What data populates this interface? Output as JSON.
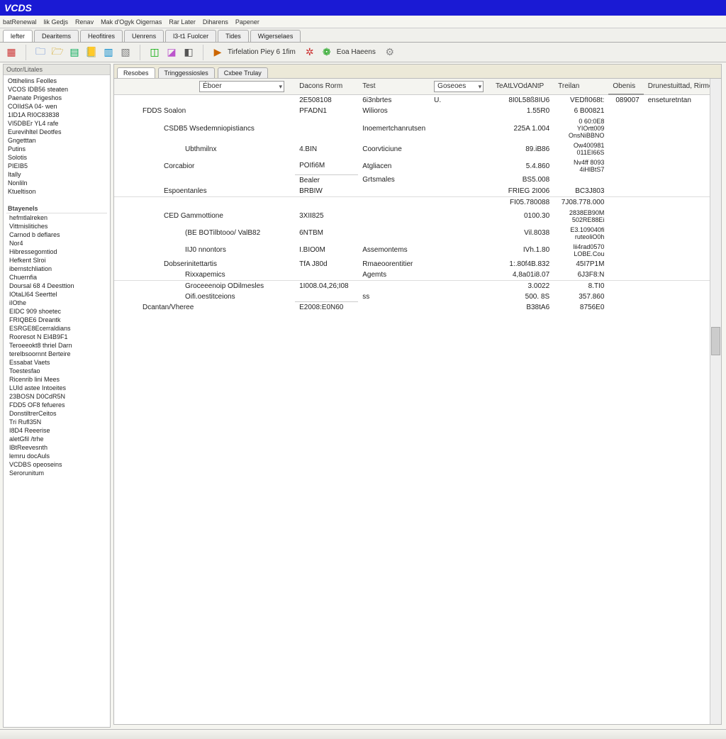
{
  "title": "VCDS",
  "menu": [
    "batRenewal",
    "lik Gedjs",
    "Renav",
    "Mak d'Ogyk Oigernas",
    "Rar Later",
    "Diharens",
    "Papener"
  ],
  "tabs": [
    "lefter",
    "Dearitems",
    "Heofitires",
    "Uenrens",
    "l3-t1  Fuolcer",
    "Tides",
    "Wigerselaes"
  ],
  "toolbar_icons": [
    "doc",
    "open",
    "open2",
    "save",
    "book",
    "sheet",
    "sheet2",
    "pict",
    "shape",
    "chart",
    "gear",
    "gear2"
  ],
  "toolbar_play": "▶",
  "toolbar_text1": "Tirfelation Piey 6 1fim",
  "toolbar_text2": "Eoa Haeens",
  "side_header": "Outor/Litales",
  "side_group1": [
    "Ottihelins Feolles",
    "VCOS IDB56 steaten",
    "Paenate  Prigeshos",
    "COIIdSA 04- wen",
    "1ID1A  RI0C83838",
    "VI5DBEr YL4  rafe",
    "Eurevihltel Deotfes",
    "Gngetttan",
    "Putins",
    "Solotis",
    "PIEIB5",
    "Itally",
    "Nonliln",
    "Ktueltison"
  ],
  "side_hdr2": "Btayenels",
  "side_group2": [
    "hefmtlalreken",
    "Vittmislitiches",
    "Carnod b deflares",
    "Nor4",
    "Hibressegomtiod",
    "Hefkent Slroi",
    "ibernstchliation",
    "Chuernfia",
    "Doursal 68 4 Deesttion",
    "IOtaLl64 Seerttel",
    "iIOthe",
    "EIDC 909 shoetec",
    "FRIQBE6 Dreantk",
    "ESRGE8Ecerraldians",
    "Rooresot N El4B9F1",
    "Teroeeokt8 thriel Darn",
    "terelbsoornnt Berteire",
    "Essabat Vaets",
    "Toestesfao",
    "Ricenrib lini Mees",
    "LUId astee  Intoeites",
    "23BOSN D0CdR5N",
    "FDD5 OF8 fefueres",
    "DonstiltrerCeitos",
    "Tri Rufl35N",
    "I8D4 Reeerise",
    "aletGfil /trhe",
    "IBtReevesnth",
    "lemru docAuls",
    "VCDBS opeoseins",
    "Serorunitum"
  ],
  "subtabs": [
    "Resobes",
    "Tringgessiosles",
    "Cxbee  Trulay"
  ],
  "grid": {
    "header_dd1": "Éboer",
    "header_col2": "Dacons Rorm",
    "header_col3": "Test",
    "header_dd2": "Goseoes",
    "header_col5": "TeAtLVOdANtP",
    "header_col6": "Treilan",
    "header_col7": "Obenis",
    "header_col8": "Drunestuittad, Rirmed",
    "rows": [
      {
        "c1": "",
        "c2": "2E508108",
        "c3": "6i3nbrtes",
        "c3b": "U.",
        "c4": "8I0L58ß8IU6",
        "c5": "VEDfI068t:",
        "c6": "089007",
        "c7": "enseturetntan"
      },
      {
        "c1": "FDDS Soalon",
        "c2": "PFADN1",
        "c3": "Wilioros",
        "c4": "1.55R0",
        "c5": "6 B00821"
      },
      {
        "indent": 2,
        "c1": "CSDB5 Wsedemniopistiancs",
        "c3": "Inoemertchanrutsen",
        "c4": "225A 1.004",
        "c5b": [
          "0 60:0E8",
          "YIOrtt009",
          "OnsNiBBNO"
        ]
      },
      {
        "indent": 3,
        "c1": "Ubthmilnx",
        "c2": "4.BIN",
        "c3": "Coorvticiune",
        "c4": "89.iB86",
        "c5b": [
          "Ow400981",
          "011EI66S"
        ]
      },
      {
        "indent": 2,
        "c1": "Corcabior",
        "c2": "POIfi6M",
        "c3": "Atgliacen",
        "c4": "5.4.860",
        "c5b": [
          "Nv4ff 8093",
          "4iHlBtS7"
        ]
      },
      {
        "c2sep": true,
        "c2": "Bealer",
        "c3": "Grtsmales",
        "c4": "BS5.008"
      },
      {
        "indent": 2,
        "c1": "Espoentanles",
        "c2": "BRBIW",
        "c4": "FRIEG 2I006",
        "c5": "BC3J803"
      },
      {
        "sep": true,
        "c4": "FI05.780088",
        "c5": "7J08.778.000"
      },
      {
        "indent": 2,
        "c1": "CED Gammottione",
        "c2": "3XII825",
        "c4": "0100.30",
        "c5b": [
          "2838EB90M",
          "502RE88Ei"
        ]
      },
      {
        "indent": 3,
        "c1": "(BE BOTilbtooo/ ValB82",
        "c2": "6NTBM",
        "c4": "Vil.8038",
        "c5b": [
          "E3.109040fi",
          "ruteoliO0h"
        ]
      },
      {
        "indent": 3,
        "c1": "IIJ0 nnontors",
        "c2": "I.BIO0M",
        "c3": "Assemontems",
        "c4": "IVh.1.80",
        "c5b": [
          "lii4rad0570",
          "LOBE.Cou"
        ]
      },
      {
        "indent": 2,
        "c1": "Dobserinitettartis",
        "c2": "TfA J80d",
        "c3": "Rmaeoorentitier",
        "c4": "1:.80f4B.832",
        "c5": "45I7P1M"
      },
      {
        "indent": 3,
        "c1": "Rixxapemics",
        "c3": "Agemts",
        "c4": "4,8a01i8.07",
        "c5": "6J3F8:N"
      },
      {
        "sep": true,
        "indent": 3,
        "c1": "Groceeenoip ODilmesles",
        "c2": "1I008.04,26;I08",
        "c4": "3.0022",
        "c5": "8.TI0"
      },
      {
        "indent": 3,
        "c1": "Oifi.oestitceions",
        "c3": "ss",
        "c4": "500. 8S",
        "c5": "357.860"
      },
      {
        "c1": "Dcantan/Vheree",
        "c2_sep": true,
        "c2": "E2008:E0N60",
        "c4": "B38tA6",
        "c5": "8756E0"
      }
    ]
  }
}
